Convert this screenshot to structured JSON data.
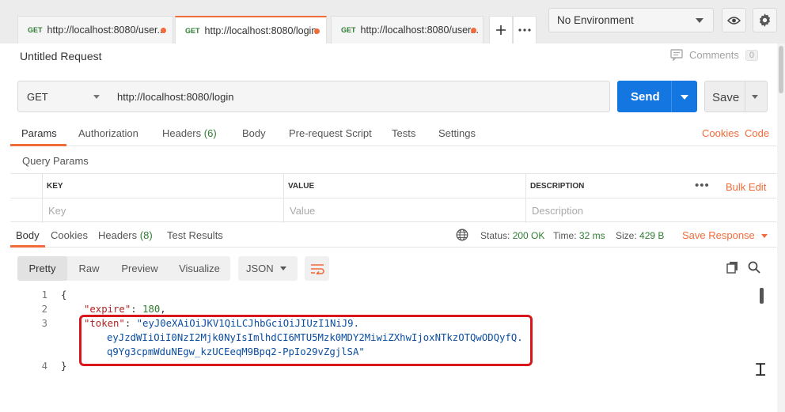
{
  "tabs": [
    {
      "method": "GET",
      "url": "http://localhost:8080/user..."
    },
    {
      "method": "GET",
      "url": "http://localhost:8080/login"
    },
    {
      "method": "GET",
      "url": "http://localhost:8080/user..."
    }
  ],
  "tab_controls": {
    "add_icon": "plus-icon",
    "more_icon": "more-horizontal-icon"
  },
  "environment": {
    "selected": "No Environment",
    "eye_icon": "eye-icon",
    "settings_icon": "gear-icon"
  },
  "request": {
    "title": "Untitled Request",
    "comments_label": "Comments",
    "comments_count": "0",
    "method": "GET",
    "url": "http://localhost:8080/login",
    "send_label": "Send",
    "save_label": "Save"
  },
  "request_tabs": [
    {
      "label": "Params"
    },
    {
      "label": "Authorization"
    },
    {
      "label": "Headers",
      "count": "(6)"
    },
    {
      "label": "Body"
    },
    {
      "label": "Pre-request Script"
    },
    {
      "label": "Tests"
    },
    {
      "label": "Settings"
    }
  ],
  "request_links": {
    "cookies": "Cookies",
    "code": "Code"
  },
  "query_params": {
    "title": "Query Params",
    "headers": {
      "key": "KEY",
      "value": "VALUE",
      "description": "DESCRIPTION"
    },
    "placeholders": {
      "key": "Key",
      "value": "Value",
      "description": "Description"
    },
    "more": "•••",
    "bulk_edit": "Bulk Edit"
  },
  "response_tabs": [
    {
      "label": "Body"
    },
    {
      "label": "Cookies"
    },
    {
      "label": "Headers",
      "count": "(8)"
    },
    {
      "label": "Test Results"
    }
  ],
  "response_status": {
    "status_label": "Status:",
    "status_value": "200 OK",
    "time_label": "Time:",
    "time_value": "32 ms",
    "size_label": "Size:",
    "size_value": "429 B",
    "save_response": "Save Response"
  },
  "view_modes": [
    "Pretty",
    "Raw",
    "Preview",
    "Visualize"
  ],
  "format": "JSON",
  "code": {
    "line_numbers": [
      "1",
      "2",
      "3",
      "4"
    ],
    "open_brace": "{",
    "close_brace": "}",
    "expire_key": "\"expire\"",
    "expire_value": "180",
    "token_key": "\"token\"",
    "token_line1": "\"eyJ0eXAiOiJKV1QiLCJhbGciOiJIUzI1NiJ9.",
    "token_line2": "eyJzdWIiOiI0NzI2Mjk0NyIsImlhdCI6MTU5Mzk0MDY2MiwiZXhwIjoxNTkzOTQwODQyfQ.",
    "token_line3": "q9Yg3cpmWduNEgw_kzUCEeqM9Bpq2-PpIo29vZgjlSA\""
  },
  "colors": {
    "accent": "#f26b3a",
    "send": "#1476e0",
    "status_ok": "#2e7d32",
    "highlight_box": "#d9161c"
  }
}
